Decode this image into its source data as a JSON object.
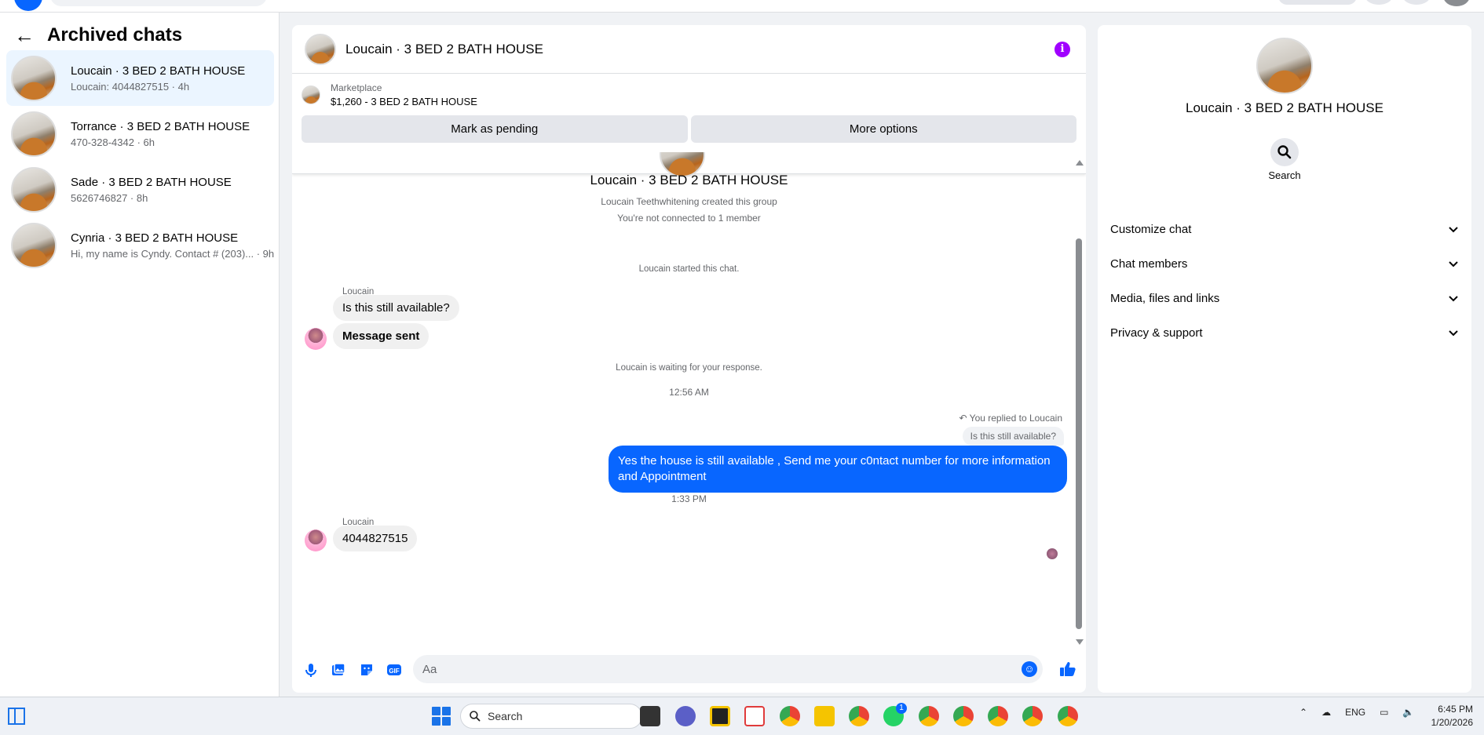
{
  "left": {
    "title": "Archived chats",
    "chats": [
      {
        "name": "Loucain · 3 BED 2 BATH HOUSE",
        "preview": "Loucain: 4044827515 · 4h"
      },
      {
        "name": "Torrance · 3 BED 2 BATH HOUSE",
        "preview": "470-328-4342 · 6h"
      },
      {
        "name": "Sade · 3 BED 2 BATH HOUSE",
        "preview": "5626746827 · 8h"
      },
      {
        "name": "Cynria · 3 BED 2 BATH HOUSE",
        "preview": "Hi, my name is Cyndy. Contact # (203)... · 9h"
      }
    ]
  },
  "conversation": {
    "title": "Loucain · 3 BED 2 BATH HOUSE",
    "marketplace": {
      "label": "Marketplace",
      "listing": "$1,260 - 3 BED 2 BATH HOUSE",
      "pending_button": "Mark as pending",
      "options_button": "More options"
    },
    "group_title": "Loucain · 3 BED 2 BATH HOUSE",
    "group_created": "Loucain Teethwhitening created this group",
    "not_connected": "You're not connected to 1 member",
    "started": "Loucain started this chat.",
    "sender1": "Loucain",
    "msg1": "Is this still available?",
    "msg2": "Message sent",
    "waiting": "Loucain is waiting for your response.",
    "time1": "12:56 AM",
    "replied_note": "You replied to Loucain",
    "quoted": "Is this still available?",
    "outgoing": "Yes the house is still available , Send me your c0ntact number for more information and Appointment",
    "time2": "1:33 PM",
    "sender2": "Loucain",
    "msg3": "4044827515",
    "composer_placeholder": "Aa"
  },
  "right": {
    "name": "Loucain · 3 BED 2 BATH HOUSE",
    "search_label": "Search",
    "sections": [
      "Customize chat",
      "Chat members",
      "Media, files and links",
      "Privacy & support"
    ]
  },
  "taskbar": {
    "search_label": "Search",
    "whatsapp_badge": "1",
    "language": "ENG",
    "time": "6:45 PM",
    "date": "1/20/2026"
  },
  "colors": {
    "accent": "#0866ff",
    "info": "#a000ff",
    "active_row": "#ebf5ff"
  }
}
